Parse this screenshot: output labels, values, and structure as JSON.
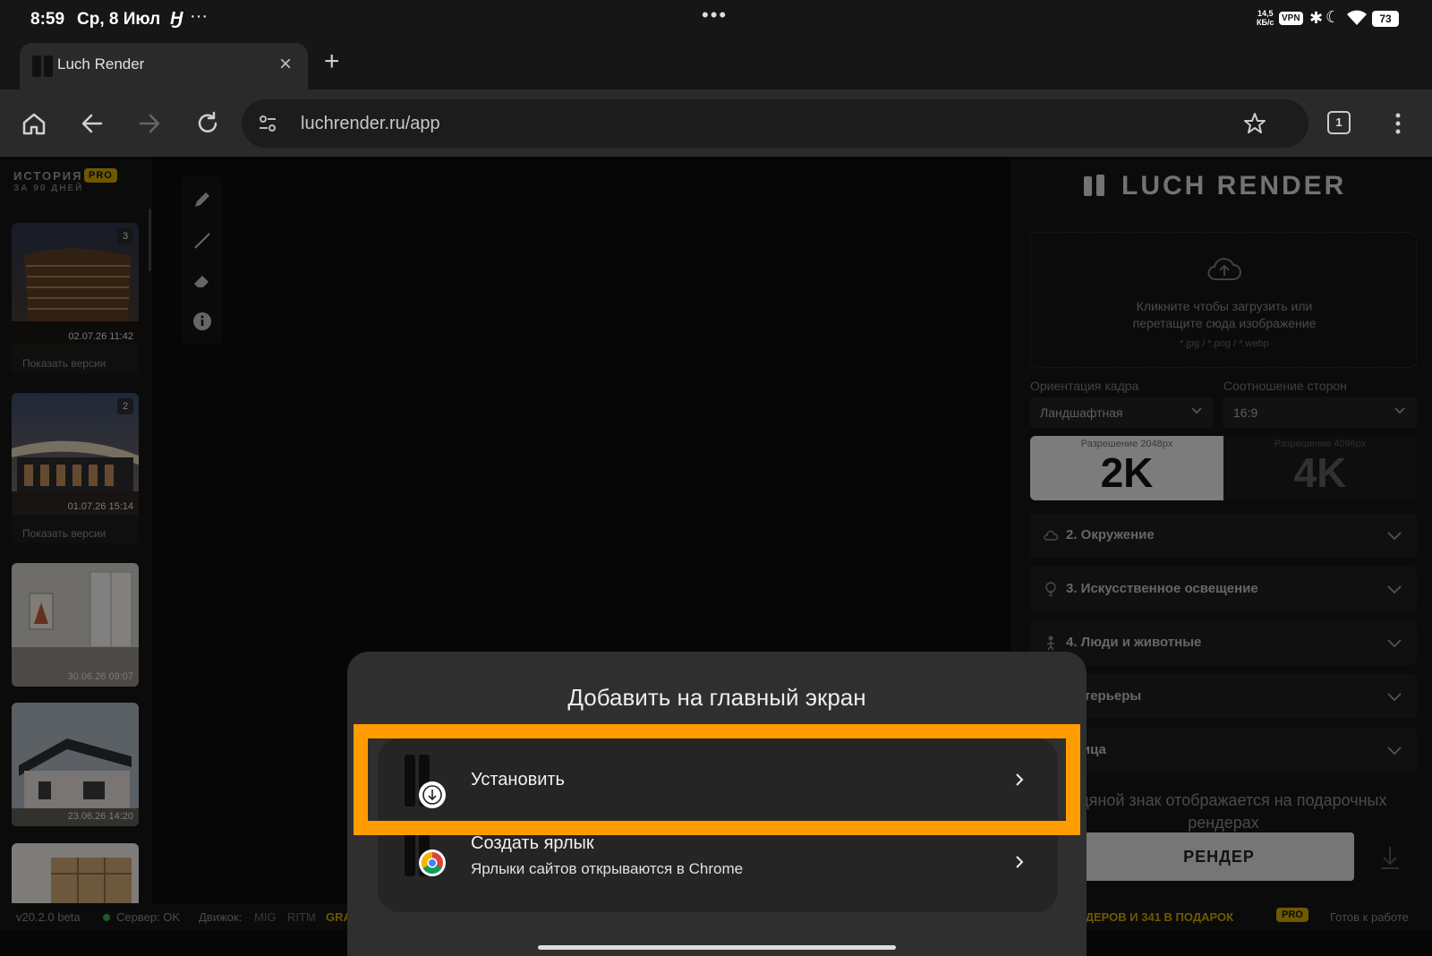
{
  "status_bar": {
    "time": "8:59",
    "date": "Ср, 8 Июл",
    "app_glyph": "Ӈ",
    "more": "···",
    "center_dots": "•••",
    "net_speed_value": "14,5",
    "net_speed_unit": "КБ/с",
    "vpn": "VPN",
    "battery": "73"
  },
  "browser": {
    "tab_title": "Luch Render",
    "new_tab": "+",
    "close_tab": "×",
    "url": "luchrender.ru/app",
    "tab_count": "1"
  },
  "history": {
    "title": "ИСТОРИЯ",
    "pro_badge": "PRO",
    "subtitle": "ЗА 90 ДНЕЙ",
    "items": [
      {
        "badge": "3",
        "date": "02.07.26 11:42",
        "versions": "Показать версии"
      },
      {
        "badge": "2",
        "date": "01.07.26 15:14",
        "versions": "Показать версии"
      },
      {
        "date": "30.06.26 09:07"
      },
      {
        "date": "23.06.26 14:20"
      }
    ]
  },
  "panel": {
    "logo": "LUCH RENDER",
    "upload_line1": "Кликните чтобы загрузить или",
    "upload_line2": "перетащите сюда изображение",
    "upload_formats": "*.jpg / *.png / *.webp",
    "orientation_label": "Ориентация кадра",
    "orientation_value": "Ландшафтная",
    "ratio_label": "Соотношение сторон",
    "ratio_value": "16:9",
    "res_2k_small": "Разрешение 2048px",
    "res_2k": "2K",
    "res_4k_small": "Разрешение 4096px",
    "res_4k": "4K",
    "sections": [
      {
        "label": "2. Окружение",
        "icon": "weather-icon"
      },
      {
        "label": "3. Искусственное освещение",
        "icon": "bulb-icon"
      },
      {
        "label": "4. Люди и животные",
        "icon": "person-icon"
      },
      {
        "label": "Интерьеры",
        "icon": "interior-icon"
      },
      {
        "label": "Улица",
        "icon": "street-icon"
      }
    ],
    "watermark_line1": "Водяной знак отображается на подарочных",
    "watermark_line2": "рендерах",
    "render_button": "РЕНДЕР"
  },
  "footer": {
    "version": "v20.2.0 beta",
    "server": "Сервер: OK",
    "engine_label": "Движок:",
    "engine_mig": "MIG",
    "engine_ritm": "RITM",
    "engine_gr": "GRA",
    "gift": "РЕНДЕРОВ И 341 В ПОДАРОК",
    "pro": "PRO",
    "status": "Готов к работе"
  },
  "sheet": {
    "title": "Добавить на главный экран",
    "install": "Установить",
    "shortcut": "Создать ярлык",
    "shortcut_sub": "Ярлыки сайтов открываются в Chrome"
  }
}
